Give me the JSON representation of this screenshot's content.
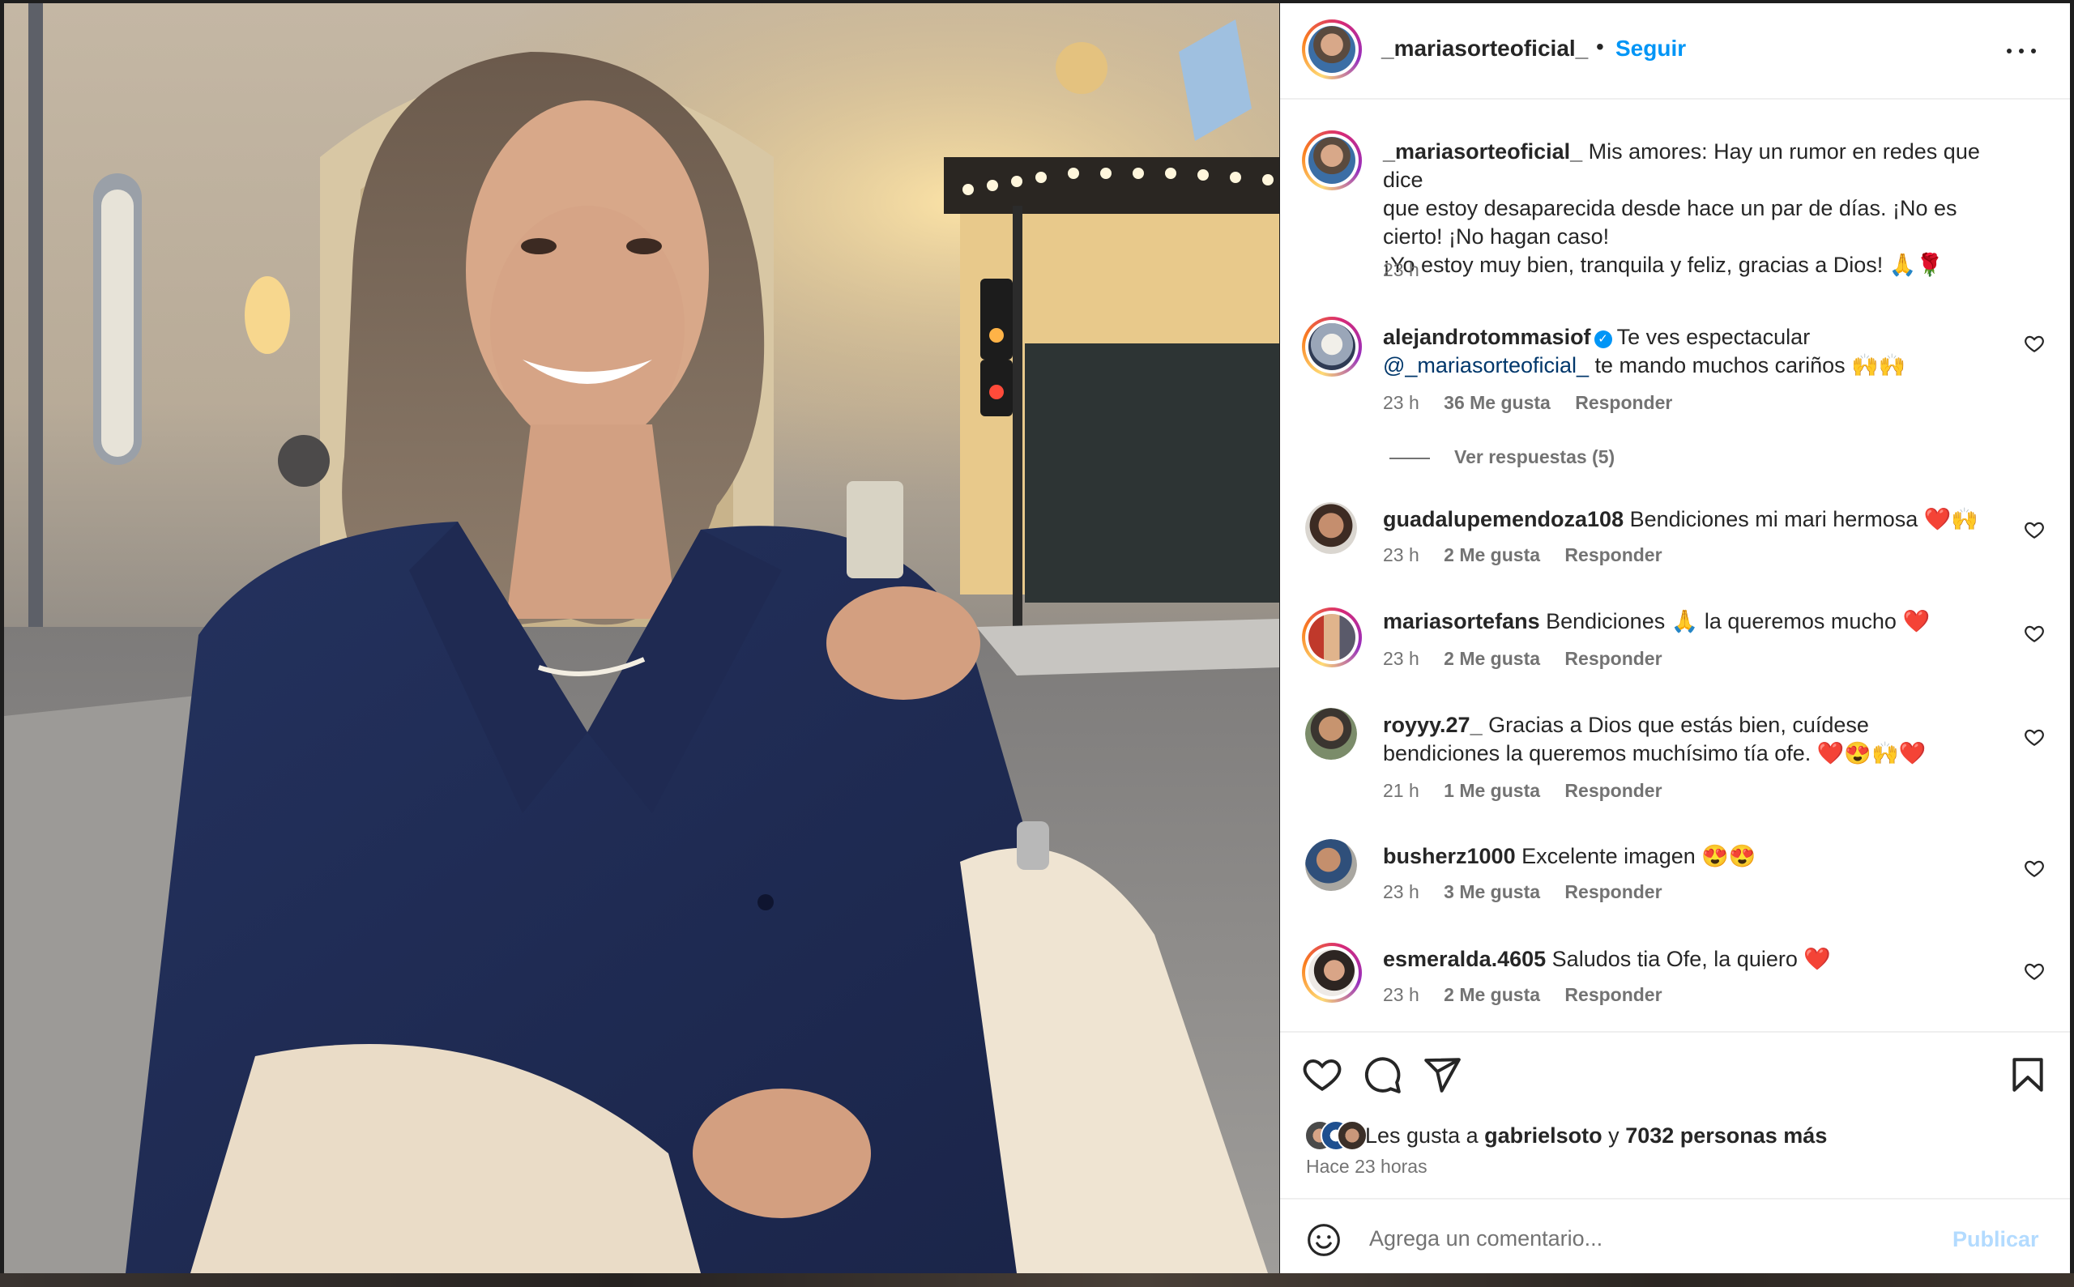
{
  "post": {
    "username": "_mariasorteoficial_",
    "separator": "•",
    "follow_label": "Seguir",
    "caption": {
      "username": "_mariasorteoficial_",
      "text_line1": "Mis amores: Hay un rumor en redes que dice",
      "text_line2": "que estoy desaparecida desde hace un par de días. ¡No es",
      "text_line3": "cierto! ¡No hagan caso!",
      "text_line4": "¡Yo estoy muy bien, tranquila y feliz, gracias a Dios! 🙏🌹",
      "time": "23 h"
    },
    "comments": [
      {
        "username": "alejandrotommasiof",
        "verified": true,
        "text_a": "Te ves espectacular",
        "mention": "@_mariasorteoficial_",
        "text_b": "te mando muchos cariños 🙌🙌",
        "time": "23 h",
        "likes": "36 Me gusta",
        "reply": "Responder",
        "view_replies": "Ver respuestas (5)"
      },
      {
        "username": "guadalupemendoza108",
        "text": "Bendiciones mi mari hermosa ❤️🙌",
        "time": "23 h",
        "likes": "2 Me gusta",
        "reply": "Responder"
      },
      {
        "username": "mariasortefans",
        "text": "Bendiciones 🙏 la queremos mucho ❤️",
        "time": "23 h",
        "likes": "2 Me gusta",
        "reply": "Responder"
      },
      {
        "username": "royyy.27_",
        "text_line1": "Gracias a Dios que estás bien, cuídese",
        "text_line2": "bendiciones la queremos muchísimo tía ofe. ❤️😍🙌❤️",
        "time": "21 h",
        "likes": "1 Me gusta",
        "reply": "Responder"
      },
      {
        "username": "busherz1000",
        "text": "Excelente imagen 😍😍",
        "time": "23 h",
        "likes": "3 Me gusta",
        "reply": "Responder"
      },
      {
        "username": "esmeralda.4605",
        "text": "Saludos tia Ofe, la quiero ❤️",
        "time": "23 h",
        "likes": "2 Me gusta",
        "reply": "Responder"
      }
    ],
    "likes_summary": {
      "prefix": "Les gusta a",
      "user": "gabrielsoto",
      "joiner": "y",
      "others": "7032 personas más"
    },
    "time_ago": "Hace 23 horas",
    "add_comment": {
      "placeholder": "Agrega un comentario...",
      "publish_label": "Publicar"
    }
  },
  "icons": {
    "more": "more-options-icon",
    "like": "heart-icon",
    "comment": "comment-icon",
    "share": "send-icon",
    "save": "bookmark-icon",
    "emoji": "emoji-icon",
    "comment_like": "heart-icon"
  },
  "colors": {
    "link_blue": "#0095f6",
    "mention": "#00376b",
    "text_primary": "#262626",
    "text_secondary": "#737373",
    "publish_disabled": "#b3dbff"
  }
}
